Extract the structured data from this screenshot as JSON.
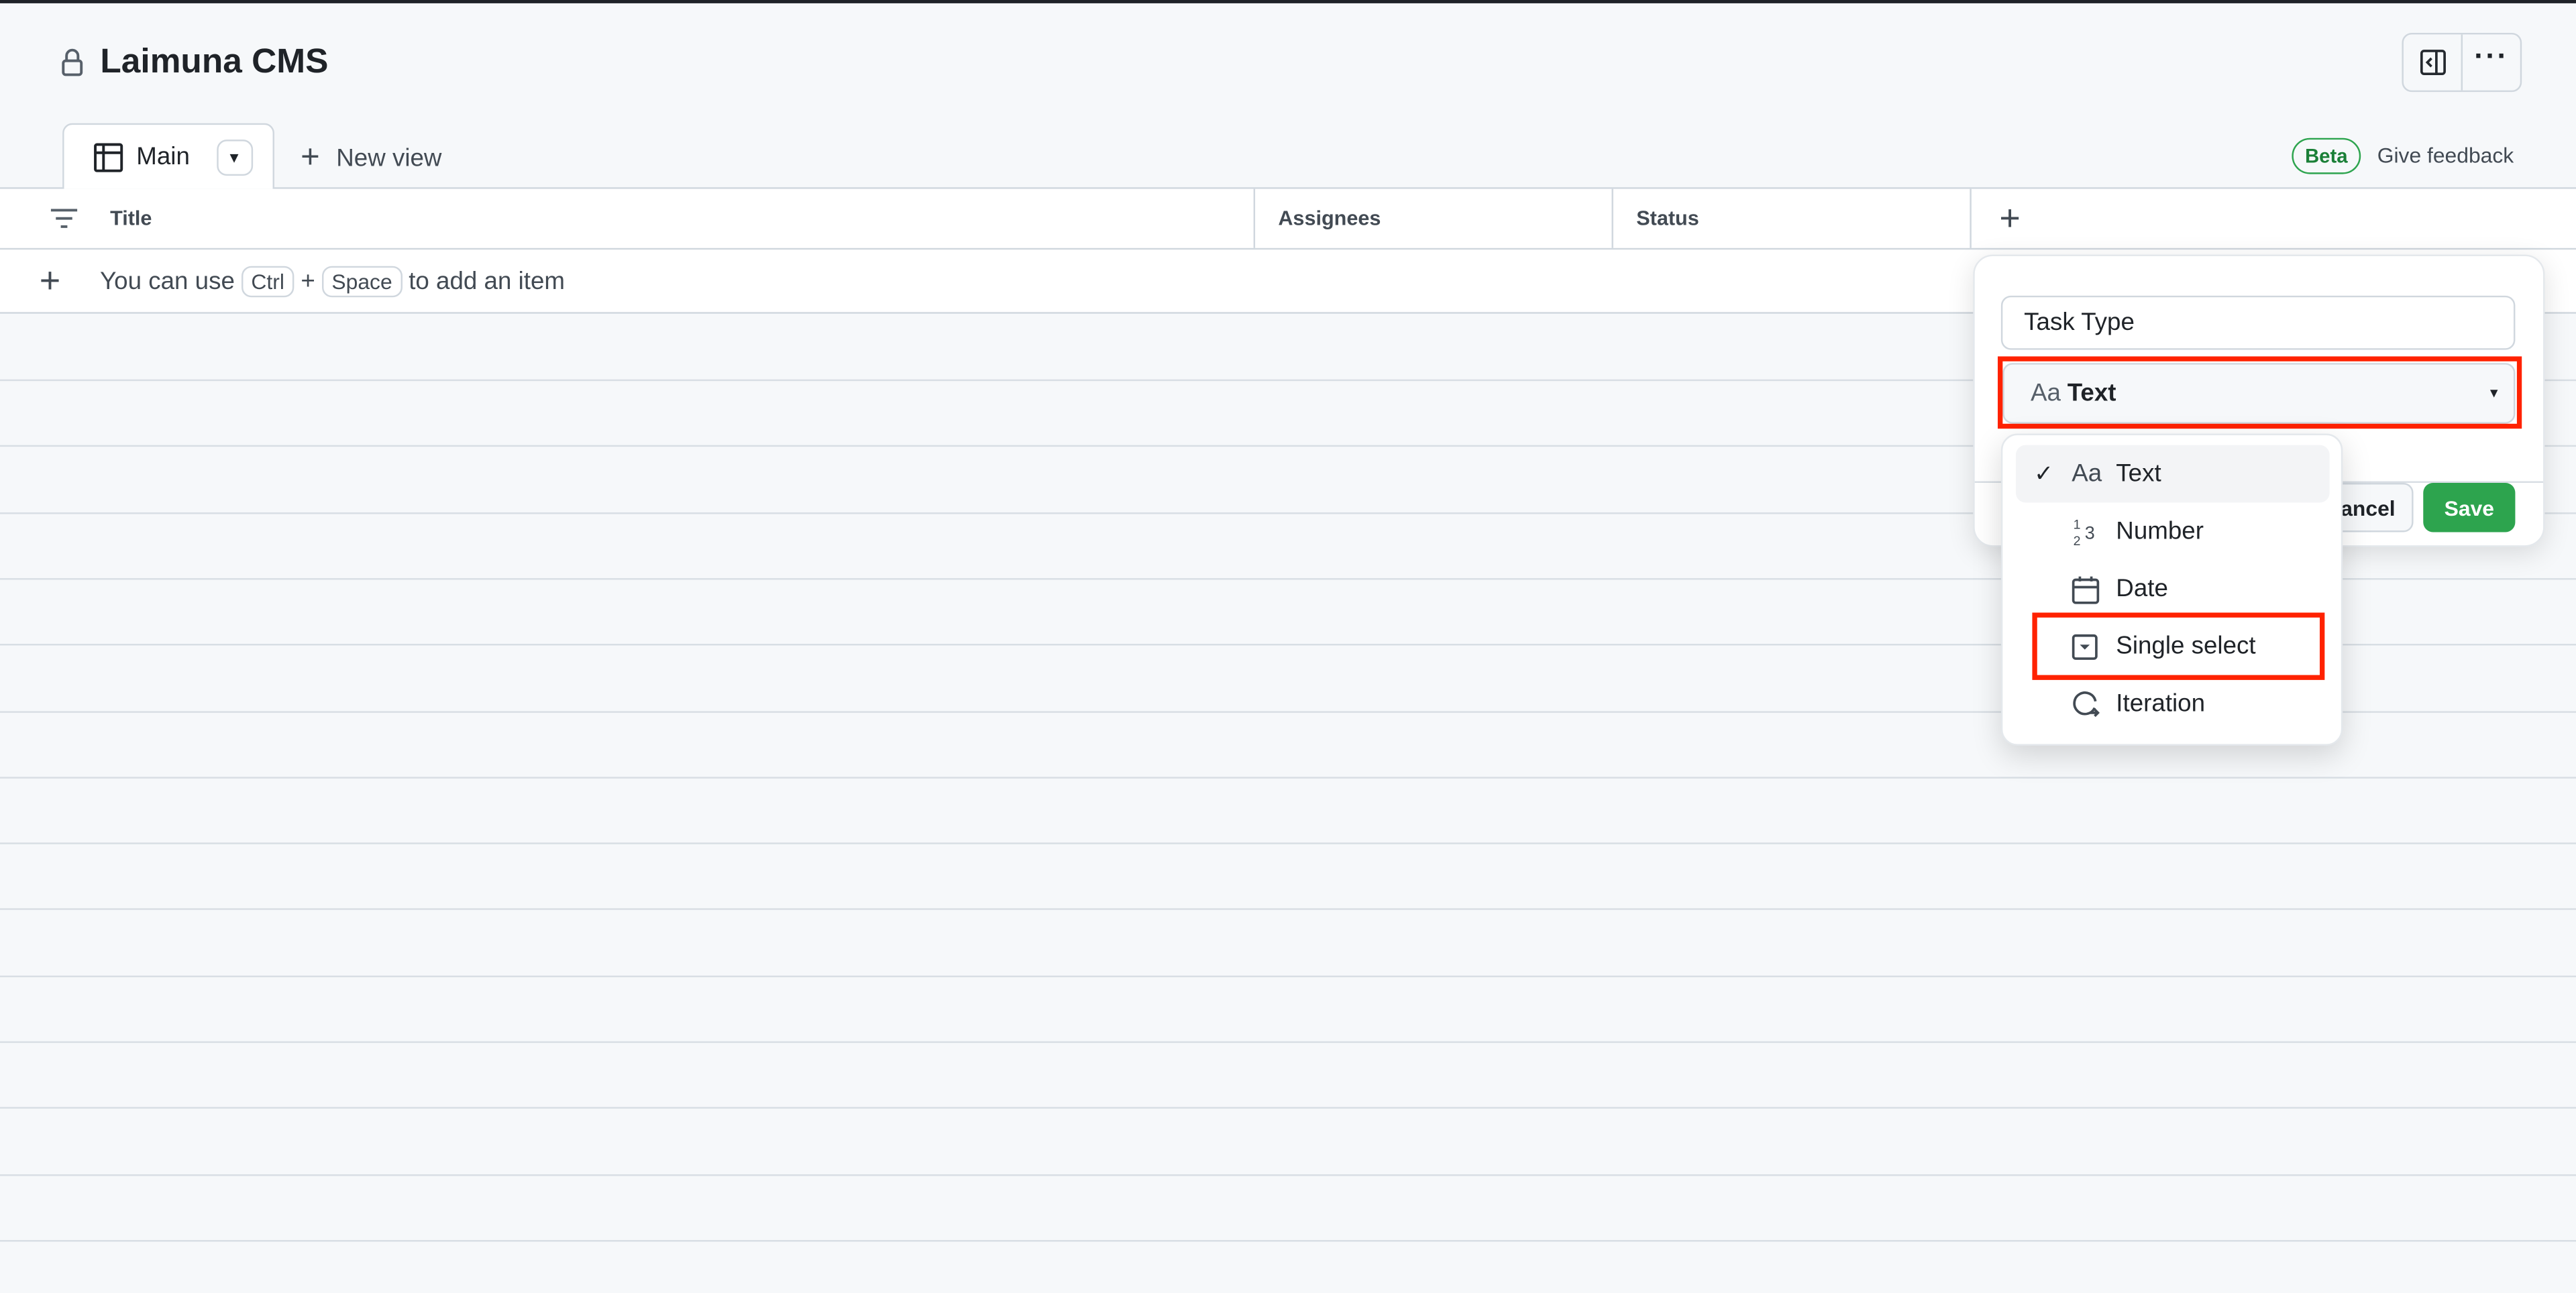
{
  "header": {
    "title": "Laimuna CMS"
  },
  "views": {
    "tabs": [
      {
        "label": "Main",
        "active": true
      }
    ],
    "new_view_label": "New view"
  },
  "beta_label": "Beta",
  "feedback_label": "Give feedback",
  "table": {
    "columns": [
      "Title",
      "Assignees",
      "Status"
    ],
    "add_hint": {
      "prefix": "You can use",
      "key1": "Ctrl",
      "plus": "+",
      "key2": "Space",
      "suffix": "to add an item"
    }
  },
  "new_field": {
    "name_value": "Task Type",
    "type_selected": "Text",
    "type_icon": "Aa",
    "cancel_label": "Cancel",
    "save_label": "Save",
    "save_color": "#2da44e",
    "options": [
      {
        "label": "Text",
        "icon": "text-aa-icon",
        "selected": true
      },
      {
        "label": "Number",
        "icon": "number-icon"
      },
      {
        "label": "Date",
        "icon": "calendar-icon"
      },
      {
        "label": "Single select",
        "icon": "single-select-icon"
      },
      {
        "label": "Iteration",
        "icon": "iteration-icon"
      }
    ]
  },
  "highlight_color": "#ff2200"
}
